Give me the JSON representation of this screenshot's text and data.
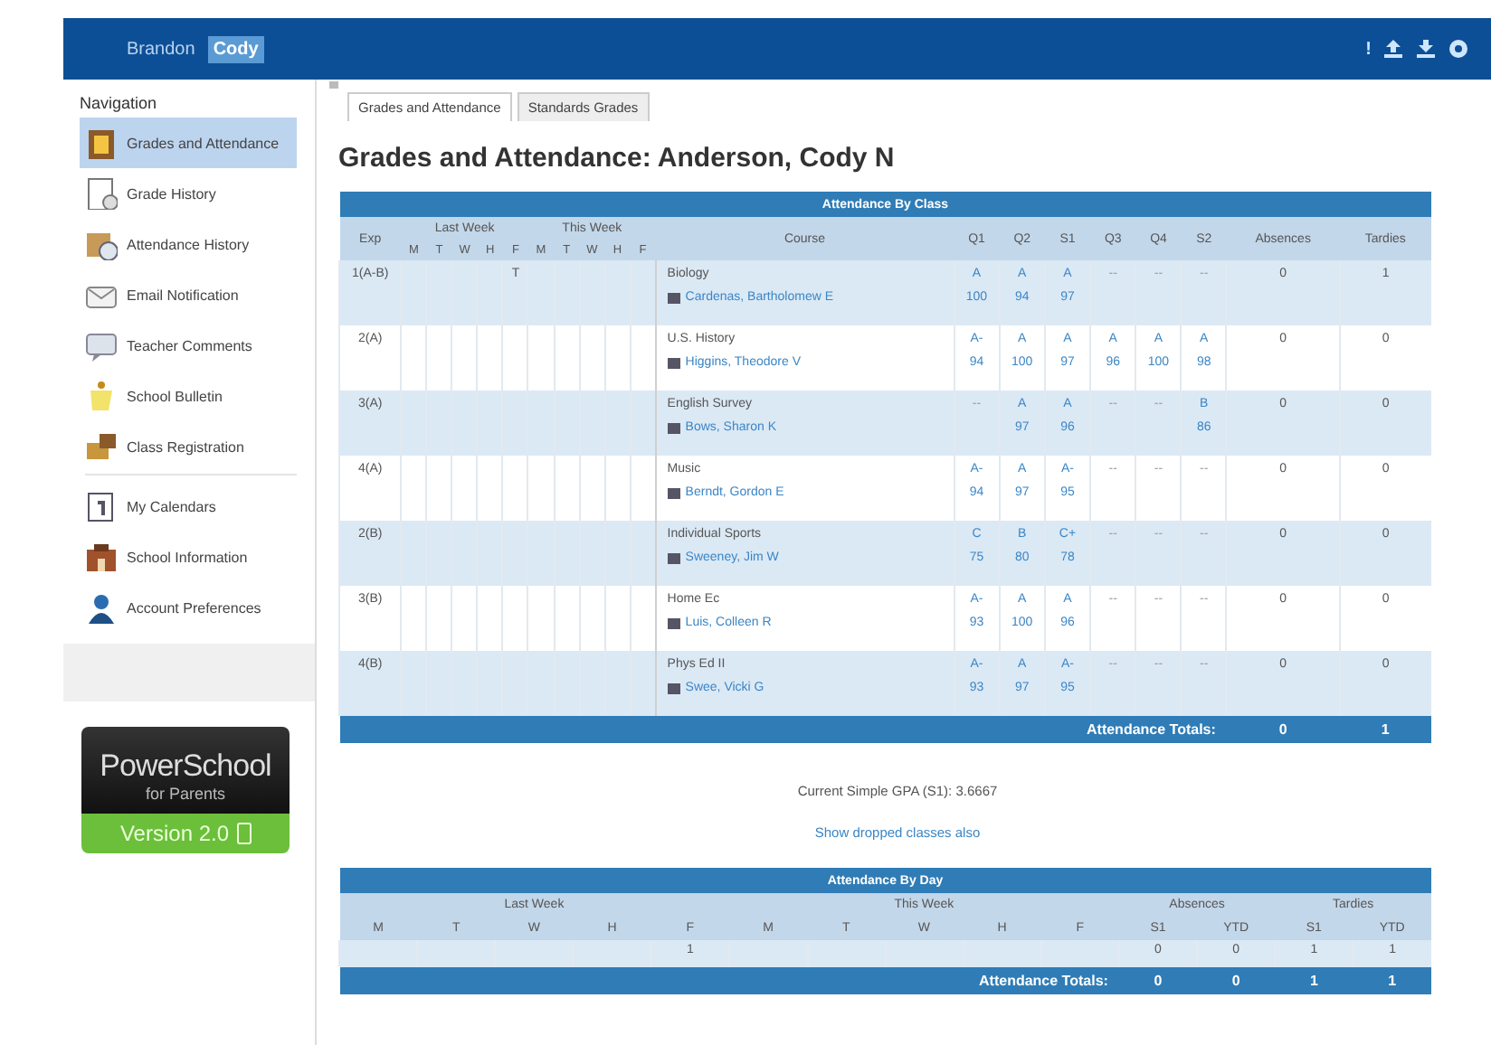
{
  "header": {
    "students": [
      {
        "name": "Brandon",
        "selected": false
      },
      {
        "name": "Cody",
        "selected": true
      }
    ],
    "alert": "!"
  },
  "navigation": {
    "title": "Navigation",
    "items": [
      {
        "label": "Grades and Attendance",
        "selected": true
      },
      {
        "label": "Grade History",
        "selected": false
      },
      {
        "label": "Attendance History",
        "selected": false
      },
      {
        "label": "Email Notification",
        "selected": false
      },
      {
        "label": "Teacher Comments",
        "selected": false
      },
      {
        "label": "School Bulletin",
        "selected": false
      },
      {
        "label": "Class Registration",
        "selected": false
      },
      {
        "label": "My Calendars",
        "selected": false
      },
      {
        "label": "School Information",
        "selected": false
      },
      {
        "label": "Account Preferences",
        "selected": false
      }
    ]
  },
  "logo": {
    "name": "PowerSchool",
    "subtitle": "for Parents",
    "version": "Version 2.0"
  },
  "tabs": [
    {
      "label": "Grades and Attendance",
      "selected": true
    },
    {
      "label": "Standards Grades",
      "selected": false
    }
  ],
  "page_title": "Grades and Attendance: Anderson, Cody N",
  "class_table": {
    "caption": "Attendance By Class",
    "exp_header": "Exp",
    "last_week": "Last Week",
    "this_week": "This Week",
    "days": [
      "M",
      "T",
      "W",
      "H",
      "F",
      "M",
      "T",
      "W",
      "H",
      "F"
    ],
    "course_header": "Course",
    "terms": [
      "Q1",
      "Q2",
      "S1",
      "Q3",
      "Q4",
      "S2"
    ],
    "absences_header": "Absences",
    "tardies_header": "Tardies",
    "rows": [
      {
        "exp": "1(A-B)",
        "attendance": {
          "last_week": {
            "F": "T"
          }
        },
        "course": "Biology",
        "teacher": "Cardenas, Bartholomew E",
        "grades": [
          {
            "letter": "A",
            "percent": "100"
          },
          {
            "letter": "A",
            "percent": "94"
          },
          {
            "letter": "A",
            "percent": "97"
          },
          {
            "letter": "--"
          },
          {
            "letter": "--"
          },
          {
            "letter": "--"
          }
        ],
        "absences": "0",
        "tardies": "1"
      },
      {
        "exp": "2(A)",
        "course": "U.S. History",
        "teacher": "Higgins, Theodore V",
        "grades": [
          {
            "letter": "A-",
            "percent": "94"
          },
          {
            "letter": "A",
            "percent": "100"
          },
          {
            "letter": "A",
            "percent": "97"
          },
          {
            "letter": "A",
            "percent": "96"
          },
          {
            "letter": "A",
            "percent": "100"
          },
          {
            "letter": "A",
            "percent": "98"
          }
        ],
        "absences": "0",
        "tardies": "0"
      },
      {
        "exp": "3(A)",
        "course": "English Survey",
        "teacher": "Bows, Sharon K",
        "grades": [
          {
            "letter": "--"
          },
          {
            "letter": "A",
            "percent": "97"
          },
          {
            "letter": "A",
            "percent": "96"
          },
          {
            "letter": "--"
          },
          {
            "letter": "--"
          },
          {
            "letter": "B",
            "percent": "86"
          }
        ],
        "absences": "0",
        "tardies": "0"
      },
      {
        "exp": "4(A)",
        "course": "Music",
        "teacher": "Berndt, Gordon E",
        "grades": [
          {
            "letter": "A-",
            "percent": "94"
          },
          {
            "letter": "A",
            "percent": "97"
          },
          {
            "letter": "A-",
            "percent": "95"
          },
          {
            "letter": "--"
          },
          {
            "letter": "--"
          },
          {
            "letter": "--"
          }
        ],
        "absences": "0",
        "tardies": "0"
      },
      {
        "exp": "2(B)",
        "course": "Individual Sports",
        "teacher": "Sweeney, Jim W",
        "grades": [
          {
            "letter": "C",
            "percent": "75"
          },
          {
            "letter": "B",
            "percent": "80"
          },
          {
            "letter": "C+",
            "percent": "78"
          },
          {
            "letter": "--"
          },
          {
            "letter": "--"
          },
          {
            "letter": "--"
          }
        ],
        "absences": "0",
        "tardies": "0"
      },
      {
        "exp": "3(B)",
        "course": "Home Ec",
        "teacher": "Luis, Colleen R",
        "grades": [
          {
            "letter": "A-",
            "percent": "93"
          },
          {
            "letter": "A",
            "percent": "100"
          },
          {
            "letter": "A",
            "percent": "96"
          },
          {
            "letter": "--"
          },
          {
            "letter": "--"
          },
          {
            "letter": "--"
          }
        ],
        "absences": "0",
        "tardies": "0"
      },
      {
        "exp": "4(B)",
        "course": "Phys Ed II",
        "teacher": "Swee, Vicki G",
        "grades": [
          {
            "letter": "A-",
            "percent": "93"
          },
          {
            "letter": "A",
            "percent": "97"
          },
          {
            "letter": "A-",
            "percent": "95"
          },
          {
            "letter": "--"
          },
          {
            "letter": "--"
          },
          {
            "letter": "--"
          }
        ],
        "absences": "0",
        "tardies": "0"
      }
    ],
    "totals_label": "Attendance Totals:",
    "absences_total": "0",
    "tardies_total": "1"
  },
  "gpa": "Current Simple GPA (S1): 3.6667",
  "dropped_link": "Show dropped classes also",
  "day_table": {
    "caption": "Attendance By Day",
    "last_week": "Last Week",
    "this_week": "This Week",
    "absences_header": "Absences",
    "tardies_header": "Tardies",
    "days": [
      "M",
      "T",
      "W",
      "H",
      "F",
      "M",
      "T",
      "W",
      "H",
      "F"
    ],
    "periods": [
      "S1",
      "YTD",
      "S1",
      "YTD"
    ],
    "attendance": {
      "last_week": {
        "F": "1"
      }
    },
    "counts": [
      "0",
      "0",
      "1",
      "1"
    ],
    "totals_label": "Attendance Totals:",
    "totals": [
      "0",
      "0",
      "1",
      "1"
    ]
  }
}
